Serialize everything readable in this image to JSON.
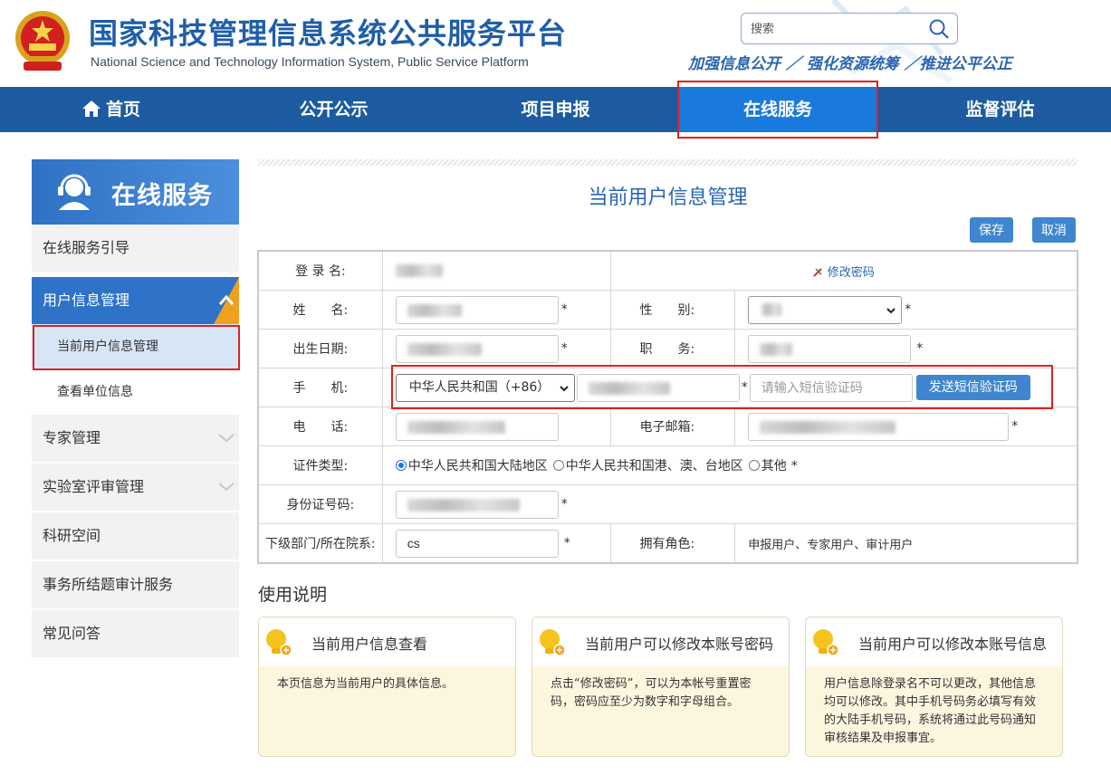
{
  "header": {
    "title": "国家科技管理信息系统公共服务平台",
    "subtitle": "National Science and Technology Information System, Public Service Platform",
    "search_placeholder": "搜索",
    "slogan": "加强信息公开 ／ 强化资源统筹 ／推进公平公正",
    "emblem_icon": "national-emblem-icon"
  },
  "nav": {
    "items": [
      {
        "label": "首页",
        "icon": "home-icon"
      },
      {
        "label": "公开公示"
      },
      {
        "label": "项目申报"
      },
      {
        "label": "在线服务"
      },
      {
        "label": "监督评估"
      }
    ],
    "active_index": 3
  },
  "sidebar": {
    "header": "在线服务",
    "items": [
      {
        "label": "在线服务引导"
      },
      {
        "label": "用户信息管理",
        "expanded": true,
        "children": [
          {
            "label": "当前用户信息管理",
            "active": true
          },
          {
            "label": "查看单位信息"
          }
        ]
      },
      {
        "label": "专家管理"
      },
      {
        "label": "实验室评审管理"
      },
      {
        "label": "科研空间"
      },
      {
        "label": "事务所结题审计服务"
      },
      {
        "label": "常见问答"
      }
    ]
  },
  "main": {
    "title": "当前用户信息管理",
    "save_label": "保存",
    "cancel_label": "取消"
  },
  "form": {
    "login_name_label": "登 录 名:",
    "change_password": "修改密码",
    "name_label": "姓　　名:",
    "gender_label": "性　　别:",
    "birth_label": "出生日期:",
    "position_label": "职　　务:",
    "mobile_label": "手　　机:",
    "country_code": "中华人民共和国（+86）",
    "sms_placeholder": "请输入短信验证码",
    "send_sms_label": "发送短信验证码",
    "phone_label": "电　　话:",
    "email_label": "电子邮箱:",
    "id_type_label": "证件类型:",
    "id_type_options": [
      "中华人民共和国大陆地区",
      "中华人民共和国港、澳、台地区",
      "其他"
    ],
    "id_type_selected": 0,
    "id_number_label": "身份证号码:",
    "department_label": "下级部门/所在院系:",
    "department_value": "cs",
    "roles_label": "拥有角色:",
    "roles_value": "申报用户、专家用户、审计用户",
    "required_mark": "*"
  },
  "usage": {
    "title": "使用说明",
    "cards": [
      {
        "title": "当前用户信息查看",
        "body": "本页信息为当前用户的具体信息。"
      },
      {
        "title": "当前用户可以修改本账号密码",
        "body": "点击“修改密码”，可以为本帐号重置密码，密码应至少为数字和字母组合。"
      },
      {
        "title": "当前用户可以修改本账号信息",
        "body": "用户信息除登录名不可以更改，其他信息均可以修改。其中手机号码务必填写有效的大陆手机号码，系统将通过此号码通知审核结果及申报事宜。"
      }
    ]
  },
  "colors": {
    "brand_blue": "#1c5ba0",
    "active_nav": "#1a79dc",
    "highlight_red": "#e02020",
    "button_blue": "#3f86cf"
  }
}
